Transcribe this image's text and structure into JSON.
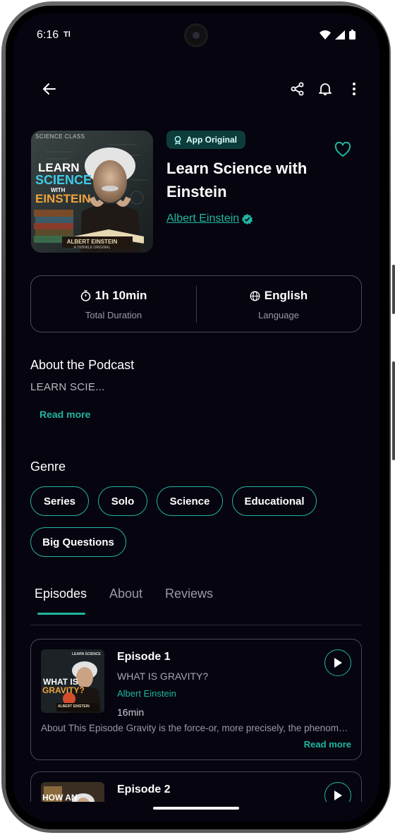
{
  "status_bar": {
    "time": "6:16",
    "extra": "Tl"
  },
  "toolbar": {
    "back_icon": "arrow-left-icon",
    "share_icon": "share-icon",
    "bell_icon": "bell-icon",
    "menu_icon": "more-vertical-icon"
  },
  "podcast": {
    "cover_text": {
      "top": "SCIENCE CLASS",
      "line1": "LEARN",
      "line2": "SCIENCE",
      "line3": "WITH",
      "line4": "EINSTEIN",
      "bottom": "ALBERT EINSTEIN",
      "brand": "A TWINKLE ORIGINAL"
    },
    "badge": "App Original",
    "title": "Learn Science with Einstein",
    "author": "Albert Einstein",
    "favorited": false
  },
  "stats": {
    "duration_value": "1h 10min",
    "duration_label": "Total Duration",
    "language_value": "English",
    "language_label": "Language"
  },
  "about": {
    "heading": "About the Podcast",
    "text": "LEARN SCIE...",
    "read_more": "Read more"
  },
  "genre": {
    "heading": "Genre",
    "chips": [
      "Series",
      "Solo",
      "Science",
      "Educational",
      "Big Questions"
    ]
  },
  "tabs": [
    "Episodes",
    "About",
    "Reviews"
  ],
  "active_tab": "Episodes",
  "episodes": [
    {
      "title": "Episode 1",
      "subtitle": "WHAT IS GRAVITY?",
      "author": "Albert Einstein",
      "duration": "16min",
      "description": "About This Episode Gravity is the force-or, more precisely, the phenomenon that pulls objects toward one another",
      "read_more": "Read more",
      "thumb_top": "LEARN SCIENCE",
      "thumb_main1": "WHAT IS",
      "thumb_main2": "GRAVITY?",
      "thumb_bottom": "ALBERT EINSTEIN"
    },
    {
      "title": "Episode 2",
      "thumb_main1": "HOW AN"
    }
  ],
  "colors": {
    "accent": "#21b6a0",
    "background": "#05040f",
    "border": "#4a4b58"
  }
}
